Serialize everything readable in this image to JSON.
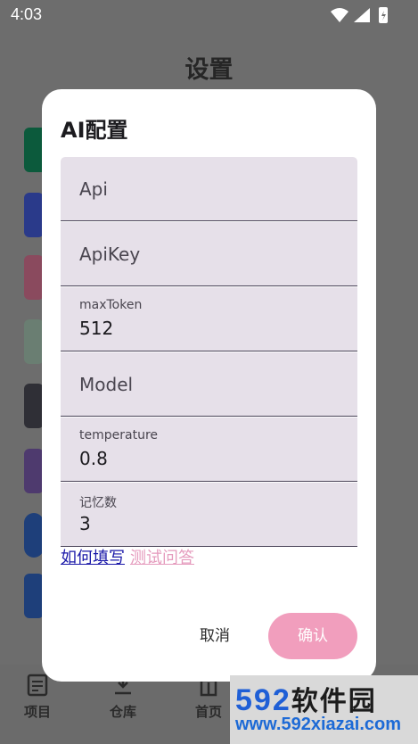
{
  "status": {
    "time": "4:03"
  },
  "background": {
    "title": "设置",
    "nav": [
      {
        "label": "项目",
        "icon": "document-icon"
      },
      {
        "label": "仓库",
        "icon": "download-icon"
      },
      {
        "label": "首页",
        "icon": "home-icon"
      }
    ]
  },
  "dialog": {
    "title": "AI配置",
    "fields": {
      "api": {
        "placeholder": "Api"
      },
      "apikey": {
        "placeholder": "ApiKey"
      },
      "maxtoken": {
        "label": "maxToken",
        "value": "512"
      },
      "model": {
        "placeholder": "Model"
      },
      "temperature": {
        "label": "temperature",
        "value": "0.8"
      },
      "memory": {
        "label": "记忆数",
        "value": "3"
      }
    },
    "links": {
      "help": "如何填写",
      "test": "测试问答"
    },
    "buttons": {
      "cancel": "取消",
      "confirm": "确认"
    }
  },
  "watermark": {
    "brand_num": "592",
    "brand_cn": "软件园",
    "url": "www.592xiazai.com"
  },
  "colors": {
    "accent": "#f19ebd",
    "field_bg": "#e6e0e9",
    "link": "#1a18a8"
  }
}
